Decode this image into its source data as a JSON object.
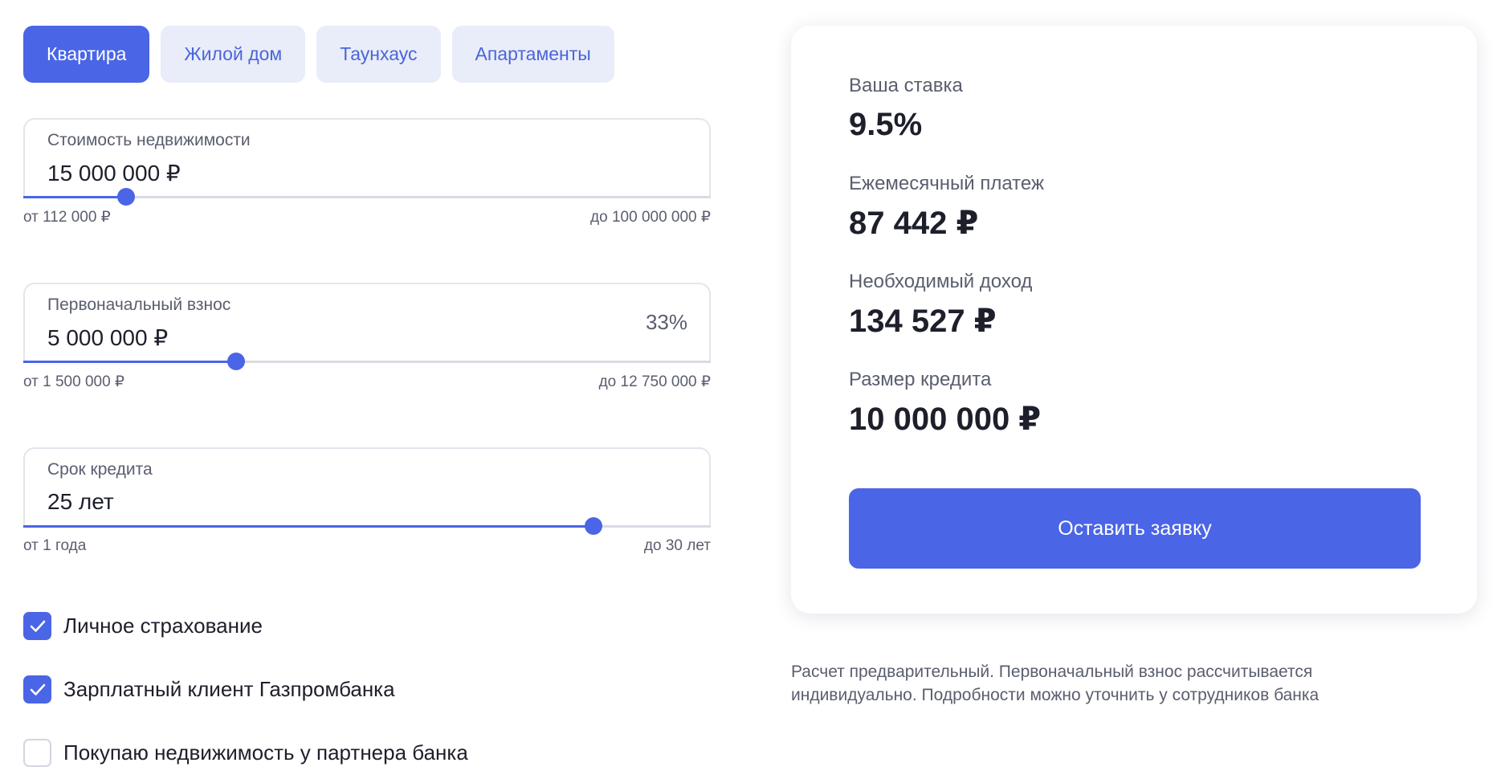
{
  "tabs": [
    {
      "label": "Квартира",
      "active": true
    },
    {
      "label": "Жилой дом",
      "active": false
    },
    {
      "label": "Таунхаус",
      "active": false
    },
    {
      "label": "Апартаменты",
      "active": false
    }
  ],
  "fields": {
    "price": {
      "label": "Стоимость недвижимости",
      "value": "15 000 000 ₽",
      "slider_fraction": 0.15,
      "min_label": "от 112 000 ₽",
      "max_label": "до 100 000 000 ₽"
    },
    "down_payment": {
      "label": "Первоначальный взнос",
      "value": "5 000 000 ₽",
      "percent": "33%",
      "slider_fraction": 0.31,
      "min_label": "от 1 500 000 ₽",
      "max_label": "до 12 750 000 ₽"
    },
    "term": {
      "label": "Срок кредита",
      "value": "25 лет",
      "slider_fraction": 0.83,
      "min_label": "от 1 года",
      "max_label": "до 30 лет"
    }
  },
  "options": [
    {
      "label": "Личное страхование",
      "checked": true
    },
    {
      "label": "Зарплатный клиент Газпромбанка",
      "checked": true
    },
    {
      "label": "Покупаю недвижимость у партнера банка",
      "checked": false
    }
  ],
  "result": {
    "rate_label": "Ваша ставка",
    "rate_value": "9.5%",
    "payment_label": "Ежемесячный платеж",
    "payment_value": "87 442 ₽",
    "income_label": "Необходимый доход",
    "income_value": "134 527 ₽",
    "loan_label": "Размер кредита",
    "loan_value": "10 000 000 ₽",
    "apply_label": "Оставить заявку"
  },
  "disclaimer": "Расчет предварительный. Первоначальный взнос рассчитывается индивидуально. Подробности можно уточнить у сотрудников банка",
  "colors": {
    "accent": "#4a65e6",
    "tab_inactive_bg": "#e9edf9",
    "tab_inactive_text": "#4a65d9"
  }
}
